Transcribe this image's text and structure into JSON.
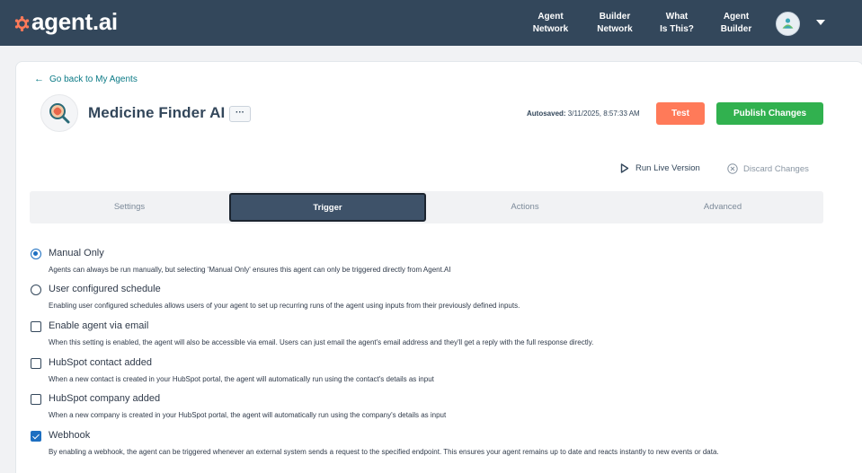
{
  "brand": {
    "name": "agent.ai",
    "accent": "#ff7a59",
    "nav_bg": "#33475b"
  },
  "nav": {
    "items": [
      {
        "line1": "Agent",
        "line2": "Network"
      },
      {
        "line1": "Builder",
        "line2": "Network"
      },
      {
        "line1": "What",
        "line2": "Is This?"
      },
      {
        "line1": "Agent",
        "line2": "Builder"
      }
    ],
    "avatar_icon": "user-avatar",
    "menu_icon": "caret-down-icon"
  },
  "header": {
    "back_link": "Go back to My Agents",
    "agent_name": "Medicine Finder AI",
    "more_label": "···",
    "autosaved_label": "Autosaved:",
    "autosaved_time": "3/11/2025, 8:57:33 AM",
    "test_label": "Test",
    "publish_label": "Publish Changes",
    "run_live_label": "Run Live Version",
    "discard_label": "Discard Changes",
    "colors": {
      "test": "#ff7a59",
      "publish": "#31b14f"
    }
  },
  "tabs": [
    {
      "label": "Settings",
      "active": false
    },
    {
      "label": "Trigger",
      "active": true
    },
    {
      "label": "Actions",
      "active": false
    },
    {
      "label": "Advanced",
      "active": false
    }
  ],
  "trigger_options": [
    {
      "type": "radio",
      "checked": true,
      "title": "Manual Only",
      "desc": "Agents can always be run manually, but selecting 'Manual Only' ensures this agent can only be triggered directly from Agent.AI"
    },
    {
      "type": "radio",
      "checked": false,
      "title": "User configured schedule",
      "desc": "Enabling user configured schedules allows users of your agent to set up recurring runs of the agent using inputs from their previously defined inputs."
    },
    {
      "type": "checkbox",
      "checked": false,
      "title": "Enable agent via email",
      "desc": "When this setting is enabled, the agent will also be accessible via email. Users can just email the agent's email address and they'll get a reply with the full response directly."
    },
    {
      "type": "checkbox",
      "checked": false,
      "title": "HubSpot contact added",
      "desc": "When a new contact is created in your HubSpot portal, the agent will automatically run using the contact's details as input"
    },
    {
      "type": "checkbox",
      "checked": false,
      "title": "HubSpot company added",
      "desc": "When a new company is created in your HubSpot portal, the agent will automatically run using the company's details as input"
    },
    {
      "type": "checkbox",
      "checked": true,
      "title": "Webhook",
      "desc": "By enabling a webhook, the agent can be triggered whenever an external system sends a request to the specified endpoint. This ensures your agent remains up to date and reacts instantly to new events or data."
    }
  ]
}
